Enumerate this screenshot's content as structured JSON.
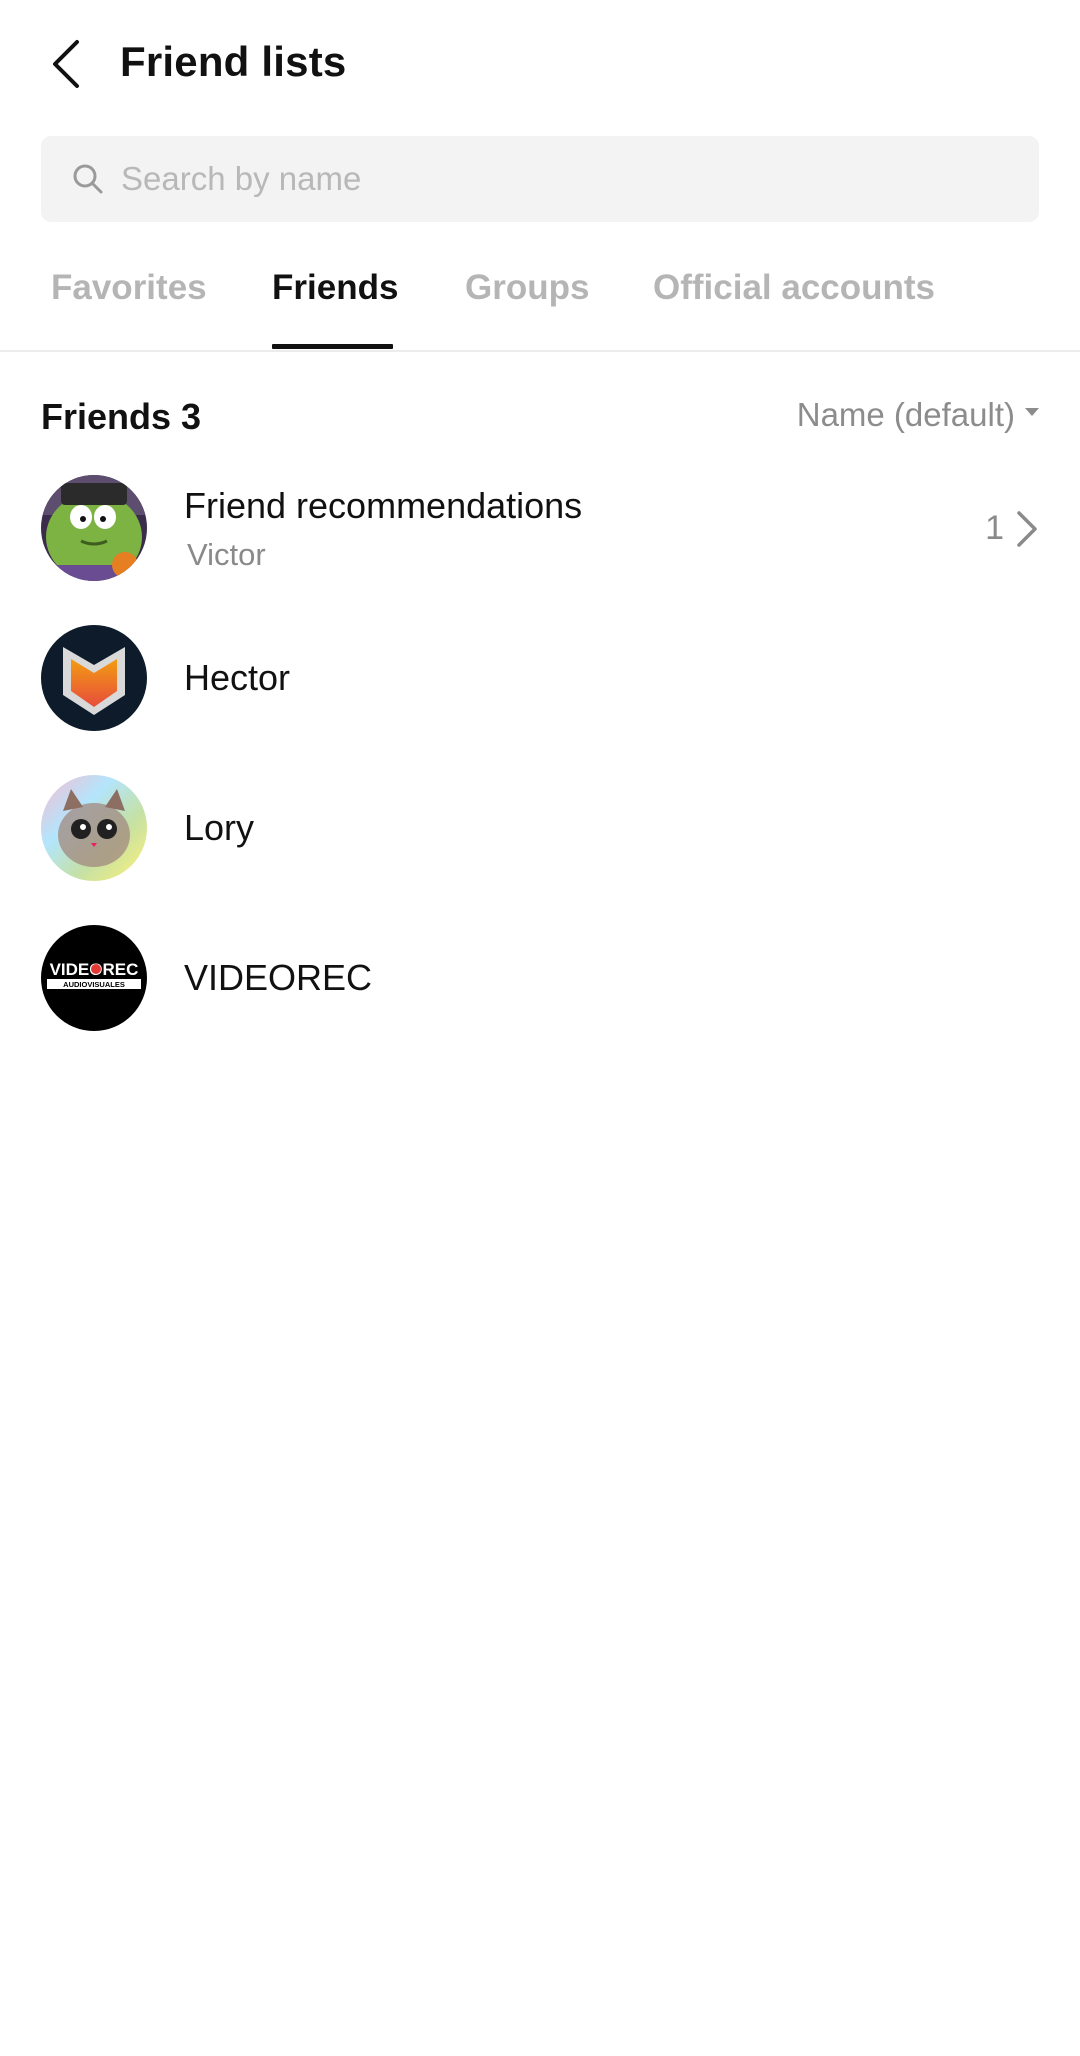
{
  "header": {
    "title": "Friend lists",
    "back_icon": "chevron-left-icon"
  },
  "search": {
    "placeholder": "Search by name",
    "value": "",
    "icon": "search-icon"
  },
  "tabs": [
    {
      "label": "Favorites",
      "active": false
    },
    {
      "label": "Friends",
      "active": true
    },
    {
      "label": "Groups",
      "active": false
    },
    {
      "label": "Official accounts",
      "active": false
    }
  ],
  "section": {
    "title": "Friends 3",
    "sort_label": "Name (default)"
  },
  "recommendations": {
    "title": "Friend recommendations",
    "subtitle": "Victor",
    "count": "1"
  },
  "friends": [
    {
      "name": "Hector"
    },
    {
      "name": "Lory"
    },
    {
      "name": "VIDEOREC"
    }
  ],
  "avatar_logo_text": {
    "videorec_main": "VIDEOREC",
    "videorec_sub": "AUDIOVISUALES"
  },
  "colors": {
    "active_tab": "#111111",
    "inactive_tab": "#b5b5b5",
    "search_bg": "#f3f3f3",
    "secondary_text": "#8a8a8a"
  }
}
